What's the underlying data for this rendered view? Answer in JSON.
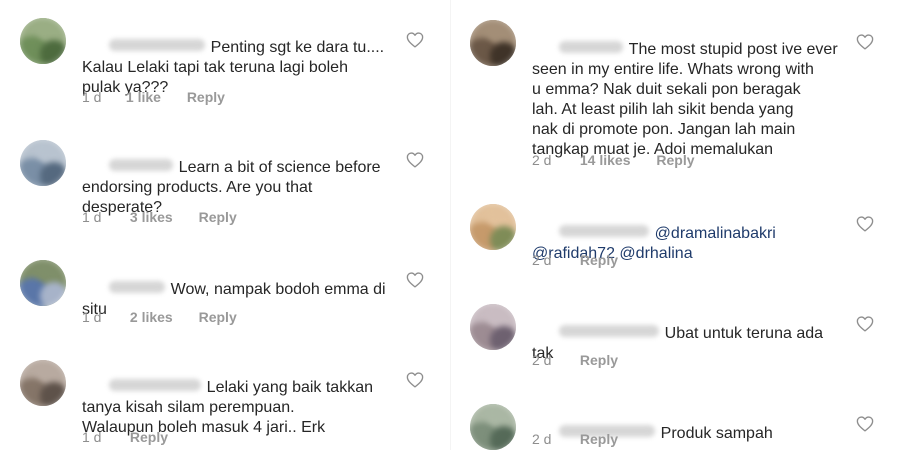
{
  "left_comments": [
    {
      "avatar_icon": "avatar-photo-icon",
      "avatar_colors": [
        "#6f8f5a",
        "#9aae84",
        "#4d6b3e"
      ],
      "text": "Penting sgt ke dara tu....\nKalau Lelaki tapi tak teruna lagi boleh\npulak ya???",
      "time": "1 d",
      "likes": "1 like",
      "reply": "Reply"
    },
    {
      "avatar_icon": "avatar-photo-icon",
      "avatar_colors": [
        "#7a8fa6",
        "#b8c3cf",
        "#55697f"
      ],
      "text": "Learn a bit of science before\nendorsing products. Are you that\ndesperate?",
      "time": "1 d",
      "likes": "3 likes",
      "reply": "Reply"
    },
    {
      "avatar_icon": "avatar-photo-icon",
      "avatar_colors": [
        "#5a76a8",
        "#7f8f6a",
        "#a7b3c9"
      ],
      "text": "Wow, nampak bodoh emma di\nsitu",
      "time": "1 d",
      "likes": "2 likes",
      "reply": "Reply"
    },
    {
      "avatar_icon": "avatar-photo-icon",
      "avatar_colors": [
        "#857568",
        "#b8aaa0",
        "#5e524a"
      ],
      "text": "Lelaki yang baik takkan\ntanya kisah silam perempuan.\nWalaupun boleh masuk 4 jari.. Erk",
      "time": "1 d",
      "likes": "",
      "reply": "Reply"
    }
  ],
  "right_comments": [
    {
      "avatar_icon": "avatar-photo-icon",
      "avatar_colors": [
        "#6b5847",
        "#a38e77",
        "#3f3328"
      ],
      "text": "The most stupid post ive ever\nseen in my entire life. Whats wrong with\nu emma? Nak duit sekali pon beragak\nlah. At least pilih lah sikit benda yang\nnak di promote pon. Jangan lah main\ntangkap muat je. Adoi memalukan",
      "mentions": [],
      "time": "2 d",
      "likes": "14 likes",
      "reply": "Reply"
    },
    {
      "avatar_icon": "avatar-photo-icon",
      "avatar_colors": [
        "#c69a6b",
        "#e2c19b",
        "#7f8c57"
      ],
      "text": "",
      "mentions": [
        "@dramalinabakri",
        "@rafidah72",
        "@drhalina"
      ],
      "time": "2 d",
      "likes": "",
      "reply": "Reply"
    },
    {
      "avatar_icon": "avatar-photo-icon",
      "avatar_colors": [
        "#9d8c93",
        "#c9bcc2",
        "#6e6170"
      ],
      "text": "Ubat untuk teruna ada\ntak",
      "mentions": [],
      "time": "2 d",
      "likes": "",
      "reply": "Reply"
    },
    {
      "avatar_icon": "avatar-photo-icon",
      "avatar_colors": [
        "#7d8f7b",
        "#aab7a4",
        "#556a58"
      ],
      "text": "Produk sampah",
      "mentions": [],
      "time": "2 d",
      "likes": "",
      "reply": "Reply"
    }
  ],
  "like_icon": "heart-outline-icon",
  "colors": {
    "text": "#262626",
    "meta": "#8e8e8e",
    "mention": "#1f3b6b",
    "heart": "#8e8e8e"
  }
}
